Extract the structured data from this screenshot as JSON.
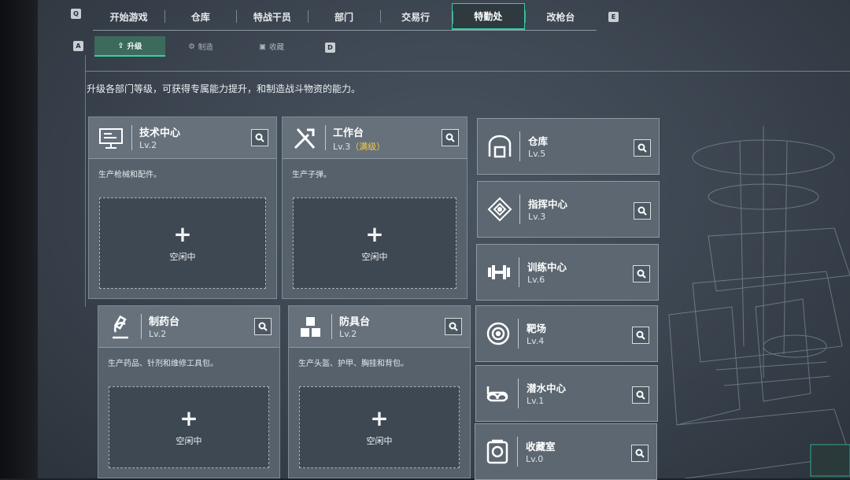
{
  "top_tabs": [
    {
      "label": "开始游戏"
    },
    {
      "label": "仓库"
    },
    {
      "label": "特战干员"
    },
    {
      "label": "部门"
    },
    {
      "label": "交易行"
    },
    {
      "label": "特勤处",
      "active": true
    },
    {
      "label": "改枪台"
    }
  ],
  "keys": {
    "prev_tab": "Q",
    "next_tab": "E",
    "prev_sub": "A",
    "next_sub": "D"
  },
  "sub_tabs": [
    {
      "label": "升级",
      "active": true
    },
    {
      "label": "制造"
    },
    {
      "label": "收藏"
    }
  ],
  "intro": "升级各部门等级，可获得专属能力提升，和制造战斗物资的能力。",
  "production_cards": [
    {
      "name": "技术中心",
      "level": "Lv.2",
      "max_label": "",
      "desc": "生产枪械和配件。",
      "slot_plus": "+",
      "slot_status": "空闲中",
      "icon": "computer-icon"
    },
    {
      "name": "工作台",
      "level": "Lv.3",
      "max_label": "（满级）",
      "desc": "生产子弹。",
      "slot_plus": "+",
      "slot_status": "空闲中",
      "icon": "tools-icon"
    },
    {
      "name": "制药台",
      "level": "Lv.2",
      "max_label": "",
      "desc": "生产药品、针剂和维修工具包。",
      "slot_plus": "+",
      "slot_status": "空闲中",
      "icon": "microscope-icon"
    },
    {
      "name": "防具台",
      "level": "Lv.2",
      "max_label": "",
      "desc": "生产头盔、护甲、胸挂和背包。",
      "slot_plus": "+",
      "slot_status": "空闲中",
      "icon": "cubes-icon"
    }
  ],
  "facility_cards": [
    {
      "name": "仓库",
      "level": "Lv.5",
      "icon": "warehouse-icon"
    },
    {
      "name": "指挥中心",
      "level": "Lv.3",
      "icon": "command-icon"
    },
    {
      "name": "训练中心",
      "level": "Lv.6",
      "icon": "dumbbell-icon"
    },
    {
      "name": "靶场",
      "level": "Lv.4",
      "icon": "target-icon"
    },
    {
      "name": "潜水中心",
      "level": "Lv.1",
      "icon": "diving-mask-icon"
    },
    {
      "name": "收藏室",
      "level": "Lv.0",
      "icon": "vault-icon"
    }
  ],
  "colors": {
    "accent": "#33d1a4",
    "max_level": "#f2c94c"
  }
}
